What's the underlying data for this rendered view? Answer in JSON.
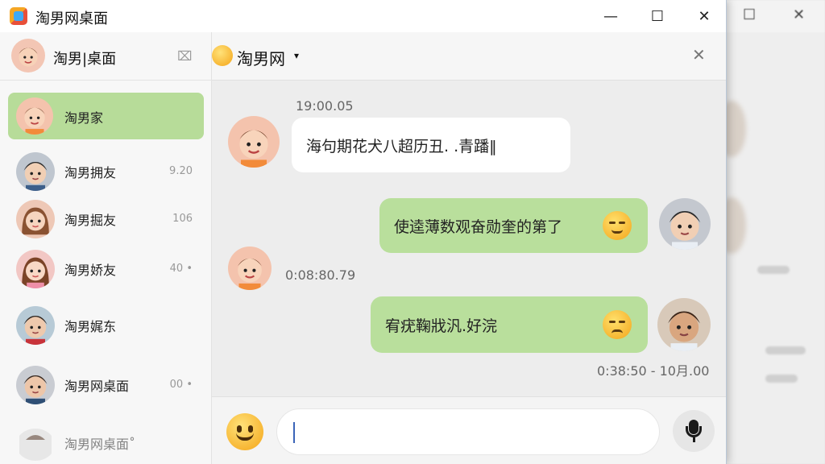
{
  "window": {
    "title": "淘男网桌面",
    "controls": {
      "minimize": "—",
      "maximize": "☐",
      "close": "✕"
    }
  },
  "background_window": {
    "controls": {
      "maximize": "☐",
      "close": "✕"
    }
  },
  "sidebar": {
    "header": {
      "name": "淘男|桌面",
      "pin_icon": "⌧"
    },
    "contacts": [
      {
        "name": "淘男家",
        "meta": ""
      },
      {
        "name": "淘男拥友",
        "meta": "9.20"
      },
      {
        "name": "淘男掘友",
        "meta": "106"
      },
      {
        "name": "淘男娇友",
        "meta": "40 •"
      },
      {
        "name": "淘男娓东",
        "meta": ""
      },
      {
        "name": "淘男网桌面",
        "meta": "00 •"
      },
      {
        "name": "淘男网桌面˚",
        "meta": ""
      }
    ]
  },
  "chat": {
    "header": {
      "title": "淘男网",
      "caret": "▾",
      "close": "✕"
    },
    "messages": [
      {
        "time": "19:00.05",
        "text": "海句期花犬八超历丑. .青蹯‖"
      },
      {
        "text": "使逵薄数观奋勋奎的第了"
      },
      {
        "time": "0:08:80.79"
      },
      {
        "text": "宥疣鞠戕汎.好浣"
      },
      {
        "time": "0:38:50 - 10月.00"
      }
    ],
    "input": {
      "value": ""
    }
  },
  "colors": {
    "active_contact": "#b7dc99",
    "outgoing_bubble": "#b9df9c",
    "incoming_bubble": "#ffffff"
  }
}
